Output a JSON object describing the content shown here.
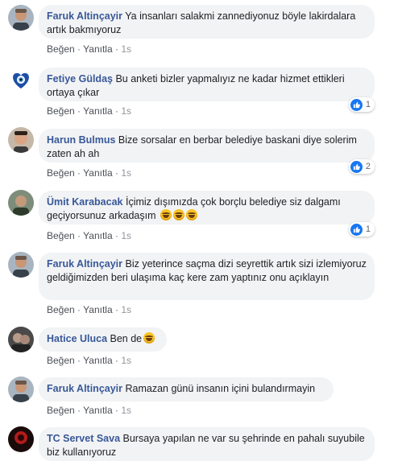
{
  "like_label": "Beğen",
  "reply_label": "Yanıtla",
  "separator": "·",
  "comments": [
    {
      "author": "Faruk Altinçayir",
      "text": "Ya insanları salakmi zannediyonuz böyle lakirdalara artık bakmıyoruz",
      "time": "1s"
    },
    {
      "author": "Fetiye Güldaş",
      "text": "Bu anketi bizler yapmalıyız ne kadar hizmet ettikleri ortaya çıkar",
      "time": "1s",
      "reactions": "1"
    },
    {
      "author": "Harun Bulmus",
      "text": "Bize sorsalar en berbar belediye baskani diye solerim zaten ah ah",
      "time": "1s",
      "reactions": "2"
    },
    {
      "author": "Ümit Karabacak",
      "text": "İçimiz dışımızda çok borçlu belediye siz dalgamı geçiyorsunuz arkadaşım",
      "time": "1s",
      "reactions": "1"
    },
    {
      "author": "Faruk Altinçayir",
      "text": "Biz yeterince saçma dizi seyrettik artık sizi izlemiyoruz geldiğimizden beri ulaşıma kaç kere zam yaptınız onu açıklayın",
      "time": "1s"
    },
    {
      "author": "Hatice Uluca",
      "text": "Ben de",
      "time": "1s"
    },
    {
      "author": "Faruk Altinçayir",
      "text": "Ramazan günü insanın içini bulandırmayin",
      "time": "1s"
    },
    {
      "author": "TC Servet Sava",
      "text": "Bursaya yapılan ne var su şehrinde en pahalı suyubile biz kullanıyoruz"
    }
  ],
  "colors": {
    "link": "#385898",
    "bubble": "#f2f3f5",
    "like_badge": "#1877f2"
  }
}
